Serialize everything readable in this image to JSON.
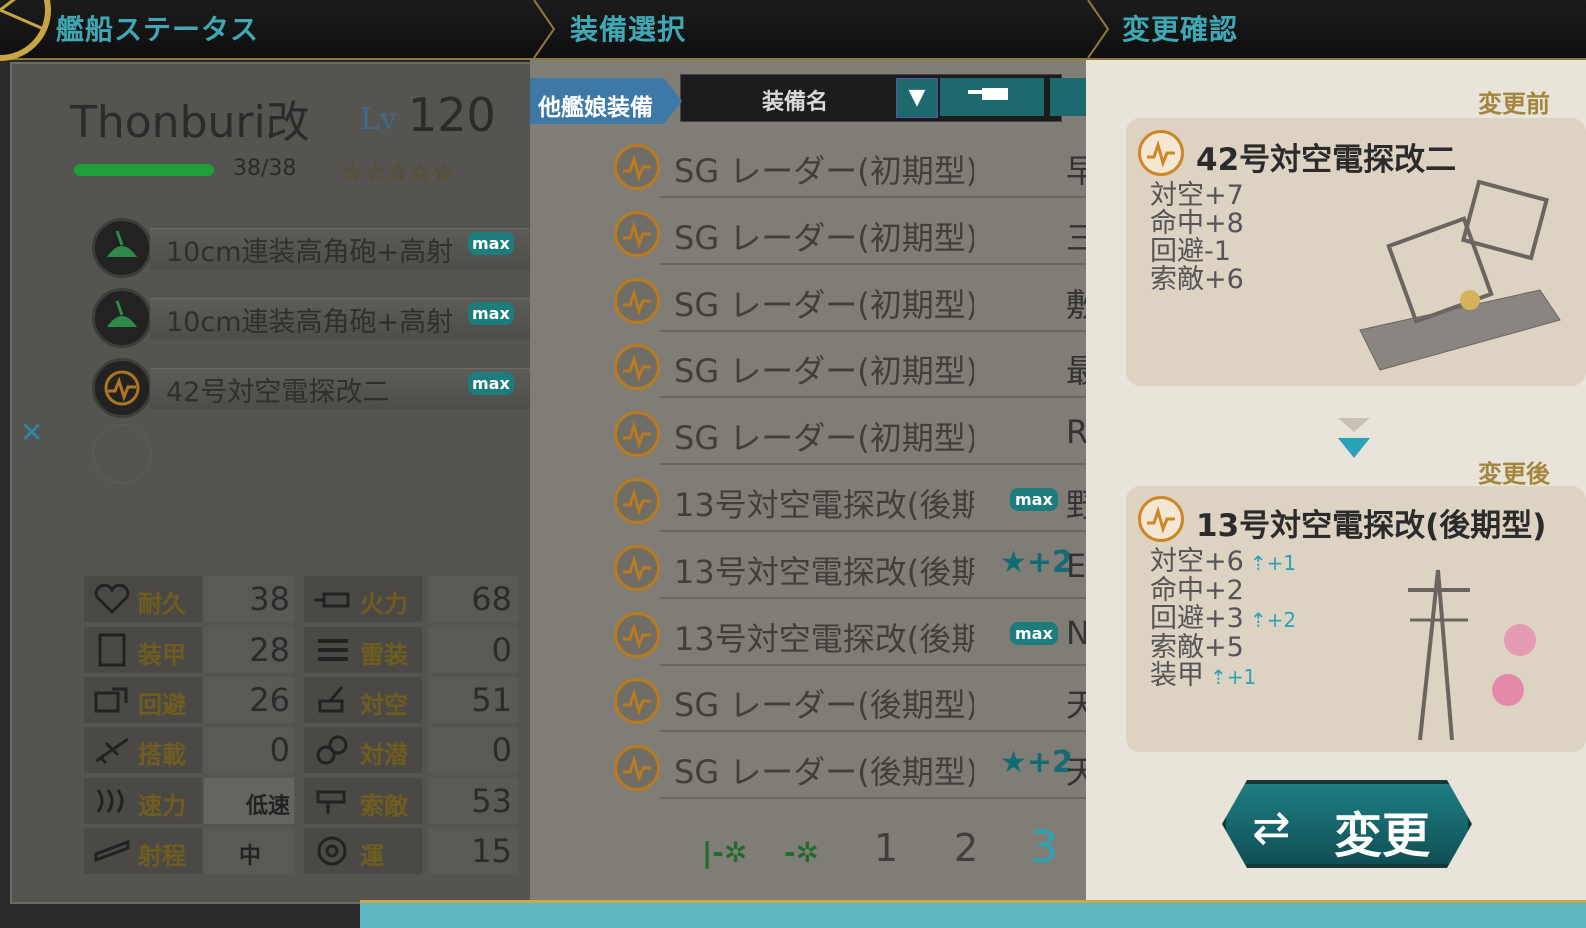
{
  "header": {
    "tab_status": "艦船ステータス",
    "tab_select": "装備選択",
    "tab_confirm": "変更確認"
  },
  "ship": {
    "name": "Thonburi改",
    "level_label": "Lv",
    "level": "120",
    "hp_text": "38/38",
    "hp_fraction": 1.0,
    "stars": "☆☆☆☆☆",
    "slots": [
      {
        "name": "10cm連装高角砲+高射",
        "badge": "max",
        "icon": "aa-gun-icon"
      },
      {
        "name": "10cm連装高角砲+高射",
        "badge": "max",
        "icon": "aa-gun-icon"
      },
      {
        "name": "42号対空電探改二",
        "badge": "max",
        "icon": "radar-icon"
      }
    ],
    "close_mark": "✕",
    "stats": [
      {
        "l_label": "耐久",
        "l_val": "38",
        "r_label": "火力",
        "r_val": "68"
      },
      {
        "l_label": "装甲",
        "l_val": "28",
        "r_label": "雷装",
        "r_val": "0"
      },
      {
        "l_label": "回避",
        "l_val": "26",
        "r_label": "対空",
        "r_val": "51"
      },
      {
        "l_label": "搭載",
        "l_val": "0",
        "r_label": "対潜",
        "r_val": "0"
      },
      {
        "l_label": "速力",
        "l_val": "低速",
        "r_label": "索敵",
        "r_val": "53"
      },
      {
        "l_label": "射程",
        "l_val": "中",
        "r_label": "運",
        "r_val": "15"
      }
    ]
  },
  "equipment_list": {
    "other_tab": "他艦娘装備",
    "sort_label": "装備名",
    "sort_arrow": "▼",
    "items": [
      {
        "name": "SG レーダー(初期型)",
        "tag": "",
        "owner": "早"
      },
      {
        "name": "SG レーダー(初期型)",
        "tag": "",
        "owner": "三"
      },
      {
        "name": "SG レーダー(初期型)",
        "tag": "",
        "owner": "敷"
      },
      {
        "name": "SG レーダー(初期型)",
        "tag": "",
        "owner": "最"
      },
      {
        "name": "SG レーダー(初期型)",
        "tag": "",
        "owner": "R"
      },
      {
        "name": "13号対空電探改(後期",
        "tag": "max",
        "owner": "野"
      },
      {
        "name": "13号対空電探改(後期",
        "tag": "★+2",
        "owner": "E"
      },
      {
        "name": "13号対空電探改(後期",
        "tag": "max",
        "owner": "N"
      },
      {
        "name": "SG レーダー(後期型)",
        "tag": "",
        "owner": "天"
      },
      {
        "name": "SG レーダー(後期型)",
        "tag": "★+2",
        "owner": "天"
      }
    ],
    "pages": [
      "1",
      "2",
      "3"
    ],
    "current_page": "3"
  },
  "confirm": {
    "before_caption": "変更前",
    "after_caption": "変更後",
    "before": {
      "name": "42号対空電探改二",
      "stats": [
        {
          "text": "対空+7",
          "bonus": ""
        },
        {
          "text": "命中+8",
          "bonus": ""
        },
        {
          "text": "回避-1",
          "bonus": ""
        },
        {
          "text": "索敵+6",
          "bonus": ""
        }
      ]
    },
    "after": {
      "name": "13号対空電探改(後期型)",
      "stats": [
        {
          "text": "対空+6",
          "bonus": "+1"
        },
        {
          "text": "命中+2",
          "bonus": ""
        },
        {
          "text": "回避+3",
          "bonus": "+2"
        },
        {
          "text": "索敵+5",
          "bonus": ""
        },
        {
          "text": "装甲",
          "bonus": "+1"
        }
      ]
    },
    "change_button": "変更"
  },
  "colors": {
    "accent_teal": "#1d7c7c",
    "gold": "#a3863c",
    "hp_green": "#1fa03a"
  }
}
